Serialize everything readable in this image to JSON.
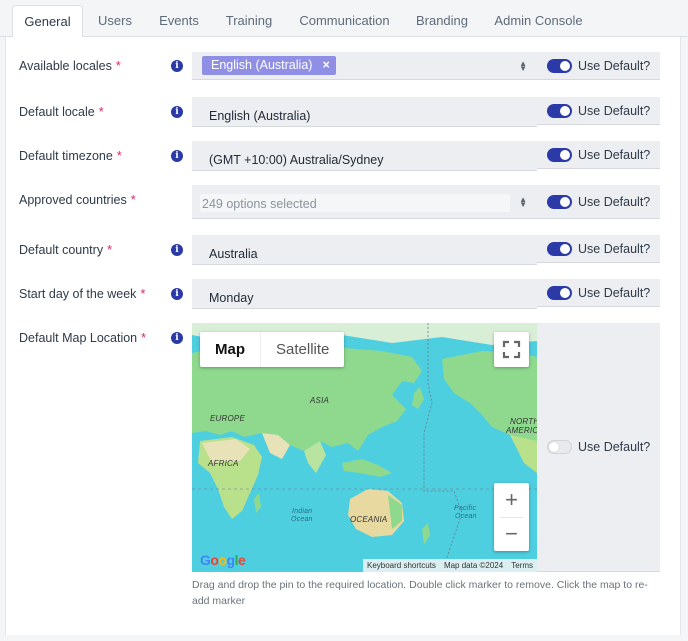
{
  "tabs": [
    {
      "label": "General",
      "active": true
    },
    {
      "label": "Users"
    },
    {
      "label": "Events"
    },
    {
      "label": "Training"
    },
    {
      "label": "Communication"
    },
    {
      "label": "Branding"
    },
    {
      "label": "Admin Console"
    }
  ],
  "required_mark": "*",
  "info_glyph": "i",
  "use_default_label": "Use Default?",
  "fields": {
    "available_locales": {
      "label": "Available locales",
      "chip": "English (Australia)",
      "chip_remove": "×",
      "use_default": true
    },
    "default_locale": {
      "label": "Default locale",
      "value": "English (Australia)",
      "use_default": true
    },
    "default_timezone": {
      "label": "Default timezone",
      "value": "(GMT +10:00) Australia/Sydney",
      "use_default": true
    },
    "approved_countries": {
      "label": "Approved countries",
      "placeholder": "249 options selected",
      "use_default": true
    },
    "default_country": {
      "label": "Default country",
      "value": "Australia",
      "use_default": true
    },
    "start_day": {
      "label": "Start day of the week",
      "value": "Monday",
      "use_default": true
    },
    "default_map_location": {
      "label": "Default Map Location",
      "use_default": false
    }
  },
  "map": {
    "type_map": "Map",
    "type_satellite": "Satellite",
    "zoom_in": "+",
    "zoom_out": "−",
    "labels": {
      "asia": "ASIA",
      "europe": "EUROPE",
      "africa": "AFRICA",
      "north_america_1": "NORTH",
      "north_america_2": "AMERIC",
      "oceania": "OCEANIA",
      "indian_ocean_1": "Indian",
      "indian_ocean_2": "Ocean",
      "pacific_ocean_1": "Pacific",
      "pacific_ocean_2": "Ocean"
    },
    "logo": "Google",
    "attribution": {
      "shortcuts": "Keyboard shortcuts",
      "data": "Map data ©2024",
      "terms": "Terms"
    }
  },
  "hint": "Drag and drop the pin to the required location. Double click marker to remove. Click the map to re-add marker",
  "colors": {
    "accent": "#2b3aa6",
    "chip": "#8f8fe6",
    "required": "#e0245e",
    "water": "#4dcfe0",
    "land": "#8fd98f"
  }
}
